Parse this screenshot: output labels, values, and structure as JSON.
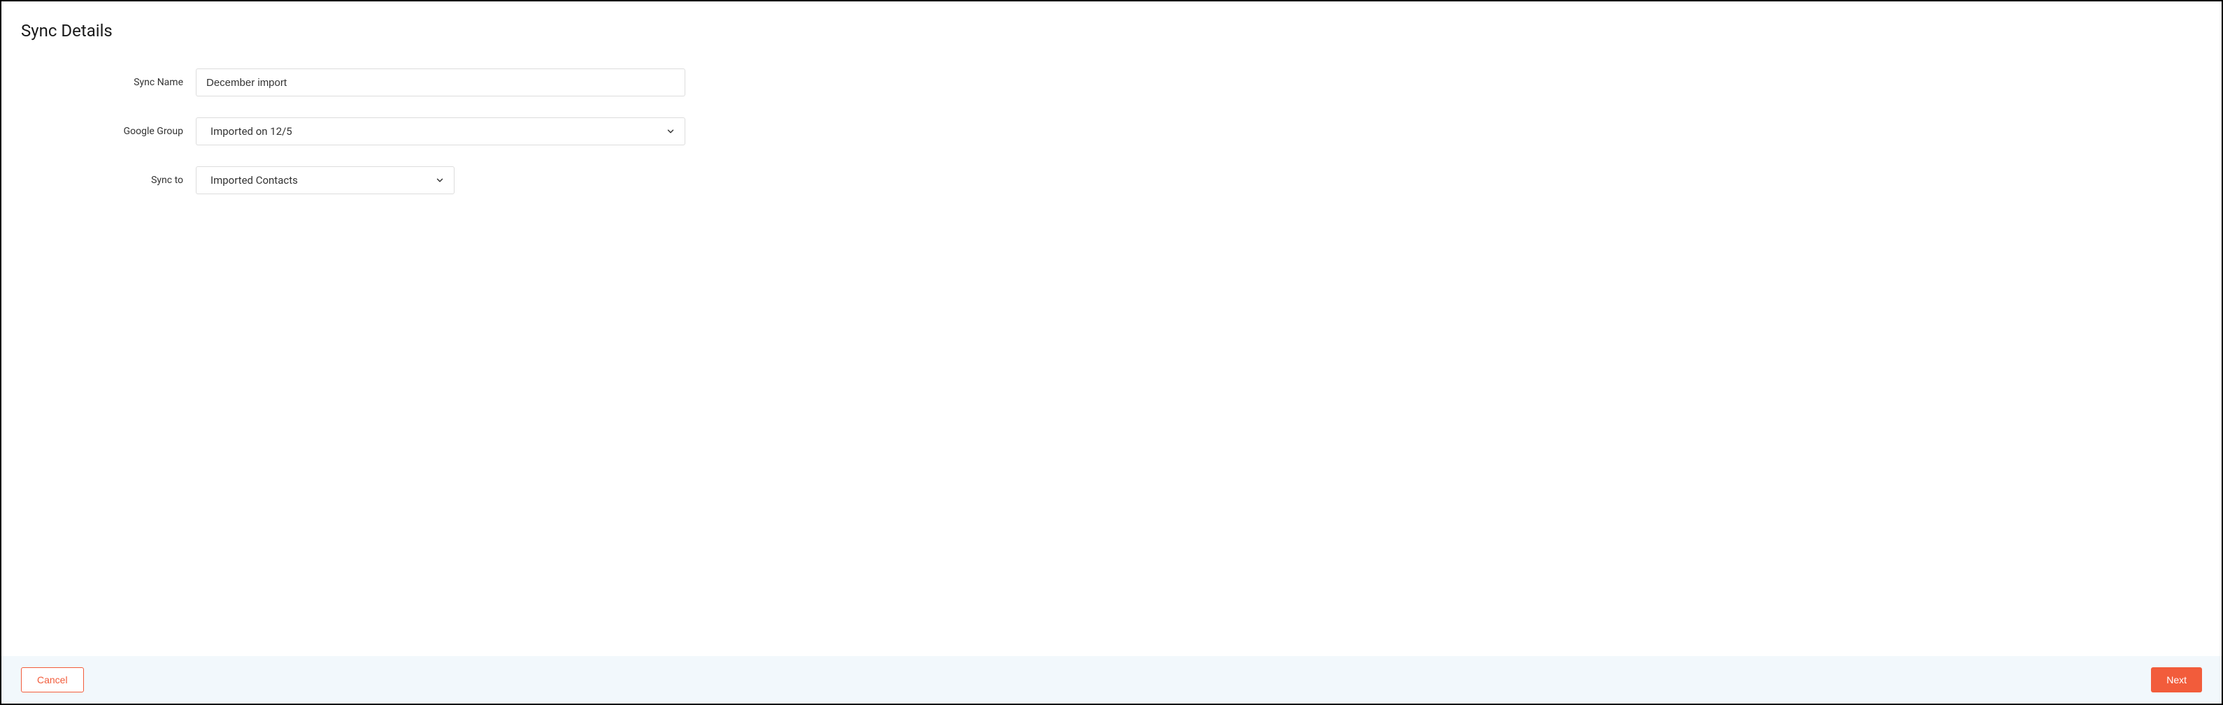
{
  "page": {
    "title": "Sync Details"
  },
  "form": {
    "syncName": {
      "label": "Sync Name",
      "value": "December import"
    },
    "googleGroup": {
      "label": "Google Group",
      "value": "Imported on 12/5"
    },
    "syncTo": {
      "label": "Sync to",
      "value": "Imported Contacts"
    }
  },
  "footer": {
    "cancel": "Cancel",
    "next": "Next"
  }
}
